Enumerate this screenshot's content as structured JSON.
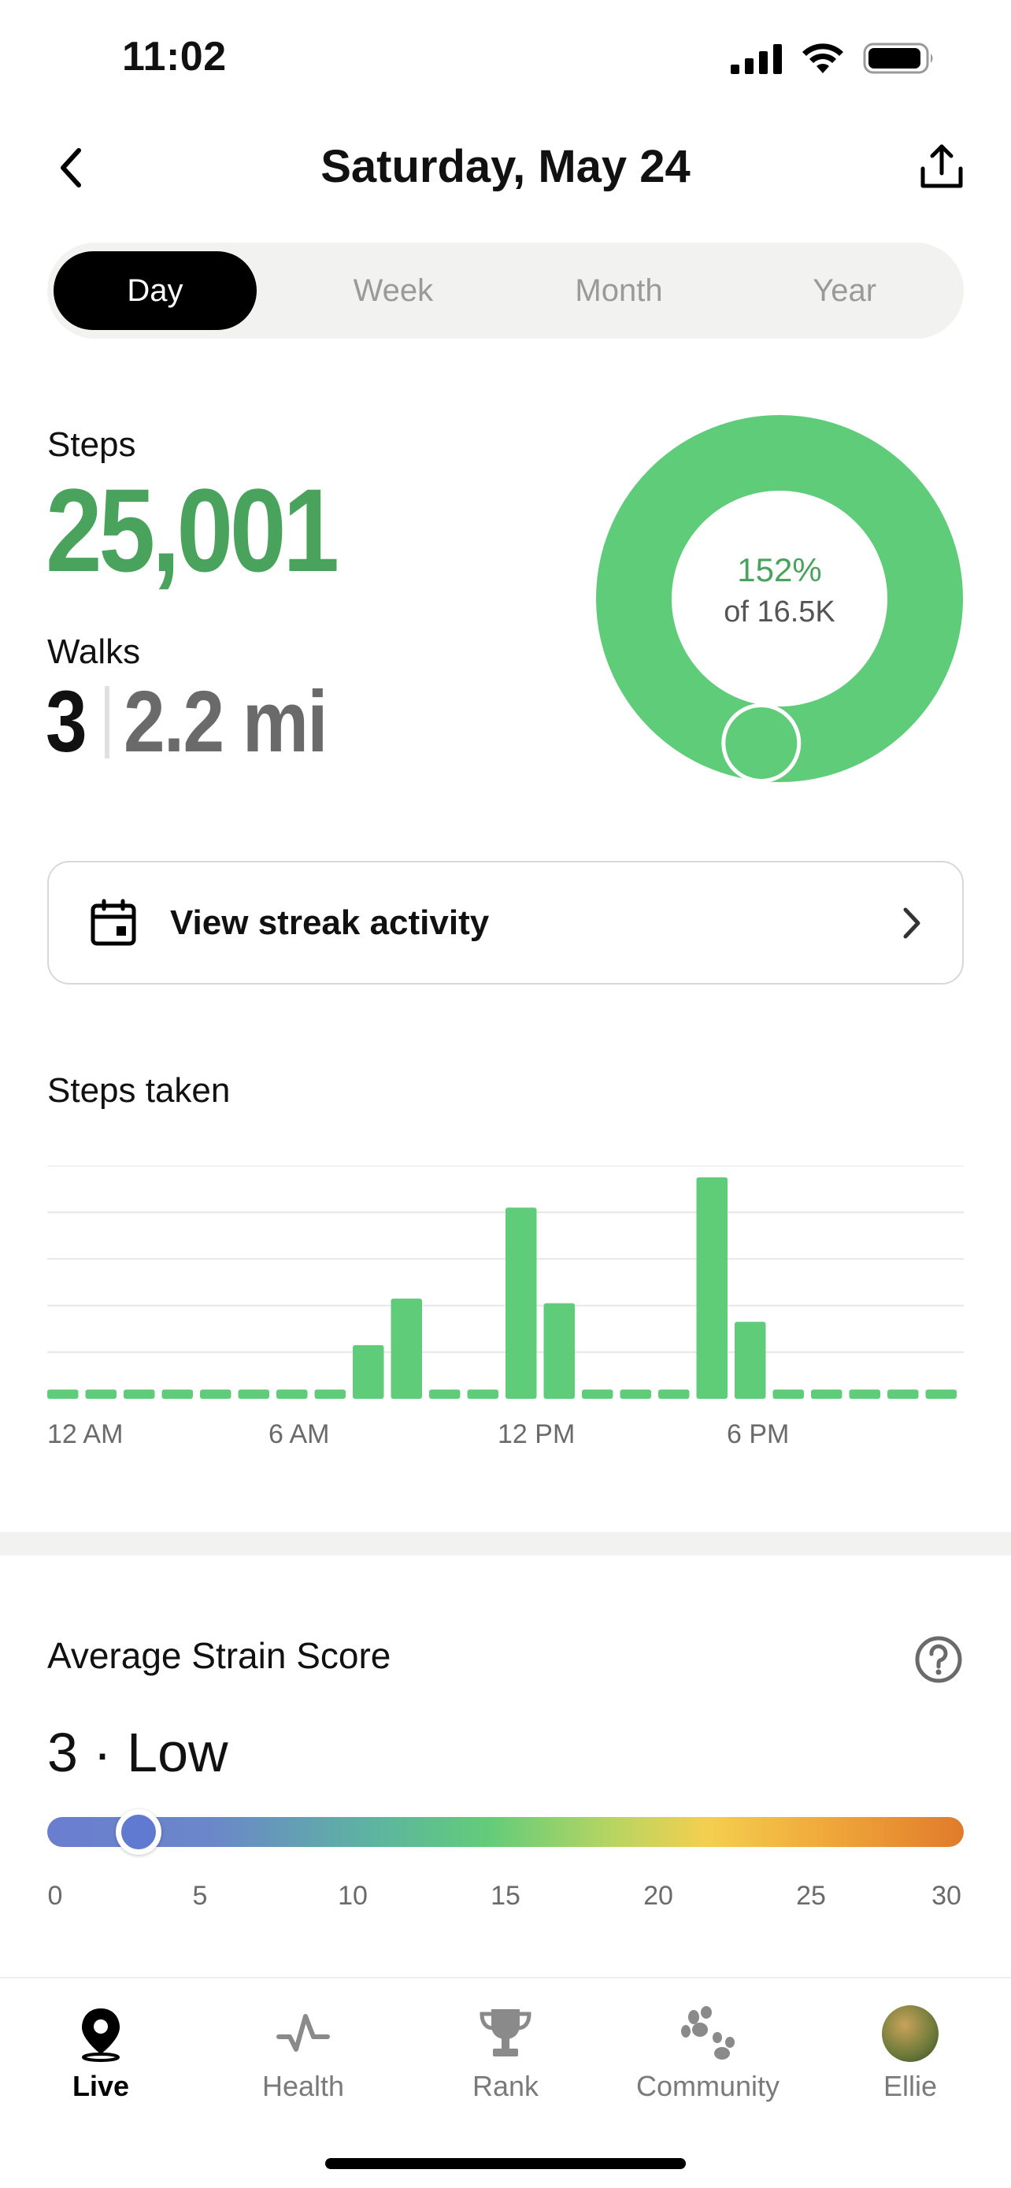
{
  "status_bar": {
    "time": "11:02"
  },
  "header": {
    "title": "Saturday, May 24"
  },
  "segments": [
    {
      "label": "Day",
      "active": true
    },
    {
      "label": "Week",
      "active": false
    },
    {
      "label": "Month",
      "active": false
    },
    {
      "label": "Year",
      "active": false
    }
  ],
  "steps": {
    "label": "Steps",
    "value": "25,001"
  },
  "walks": {
    "label": "Walks",
    "count": "3",
    "distance": "2.2 mi"
  },
  "goal_ring": {
    "percent_text": "152%",
    "goal_text": "of 16.5K",
    "progress_fraction": 1.52,
    "color": "#5fcc7a"
  },
  "streak": {
    "label": "View streak activity"
  },
  "steps_chart": {
    "title": "Steps taken",
    "x_ticks": [
      "12 AM",
      "6 AM",
      "12 PM",
      "6 PM"
    ]
  },
  "chart_data": {
    "type": "bar",
    "title": "Steps taken",
    "categories": [
      "0",
      "1",
      "2",
      "3",
      "4",
      "5",
      "6",
      "7",
      "8",
      "9",
      "10",
      "11",
      "12",
      "13",
      "14",
      "15",
      "16",
      "17",
      "18",
      "19",
      "20",
      "21",
      "22",
      "23"
    ],
    "x_tick_labels": [
      "12 AM",
      "6 AM",
      "12 PM",
      "6 PM"
    ],
    "values": [
      0.04,
      0.04,
      0.04,
      0.04,
      0.04,
      0.04,
      0.04,
      0.04,
      0.23,
      0.43,
      0.04,
      0.04,
      0.82,
      0.41,
      0.04,
      0.04,
      0.04,
      0.95,
      0.33,
      0.04,
      0.04,
      0.04,
      0.04,
      0.04
    ],
    "grid": true,
    "color": "#5fcc7a"
  },
  "strain": {
    "title": "Average Strain Score",
    "value_text": "3 · Low",
    "score": 3,
    "min": 0,
    "max": 30,
    "ticks": [
      "0",
      "5",
      "10",
      "15",
      "20",
      "25",
      "30"
    ]
  },
  "tabs": [
    {
      "label": "Live",
      "icon": "location-pin-icon",
      "active": true
    },
    {
      "label": "Health",
      "icon": "pulse-icon",
      "active": false
    },
    {
      "label": "Rank",
      "icon": "trophy-icon",
      "active": false
    },
    {
      "label": "Community",
      "icon": "paw-icon",
      "active": false
    },
    {
      "label": "Ellie",
      "icon": "avatar",
      "active": false
    }
  ]
}
